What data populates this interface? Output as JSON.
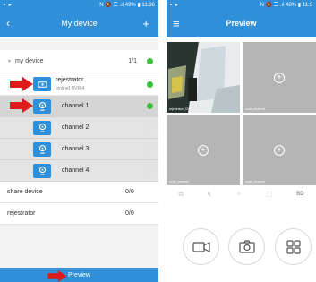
{
  "left": {
    "status_right": "N 🔕 ☰ .ıl 49% ▮ 11:36",
    "title": "My device",
    "back_icon": "‹",
    "add_icon": "+",
    "group": {
      "name": "my device",
      "count": "1/1"
    },
    "device": {
      "name": "rejestrator",
      "status": "[online] NVR-4"
    },
    "channels": [
      {
        "label": "channel 1",
        "online": true
      },
      {
        "label": "channel 2",
        "online": false
      },
      {
        "label": "channel 3",
        "online": false
      },
      {
        "label": "channel 4",
        "online": false
      }
    ],
    "rows": [
      {
        "label": "share device",
        "count": "0/0"
      },
      {
        "label": "rejestrator",
        "count": "0/0"
      }
    ],
    "preview_label": "Preview",
    "accent": "#2f8fd8",
    "online_color": "#3cbf3c",
    "arrow_color": "#e11a1a"
  },
  "right": {
    "status_right": "N 🔕 ☰ .ıl 48% ▮ 11:3",
    "title": "Preview",
    "menu_icon": "≡",
    "cells": [
      {
        "caption": "rejestrator_CH1",
        "has_video": true
      },
      {
        "caption": "sone_channel",
        "has_video": false
      },
      {
        "caption": "sone_channel",
        "has_video": false
      },
      {
        "caption": "sone_channel",
        "has_video": false
      }
    ],
    "toolbar": {
      "bd": "BD"
    },
    "icons": [
      "record-icon",
      "snapshot-icon",
      "layout-grid-icon"
    ]
  }
}
